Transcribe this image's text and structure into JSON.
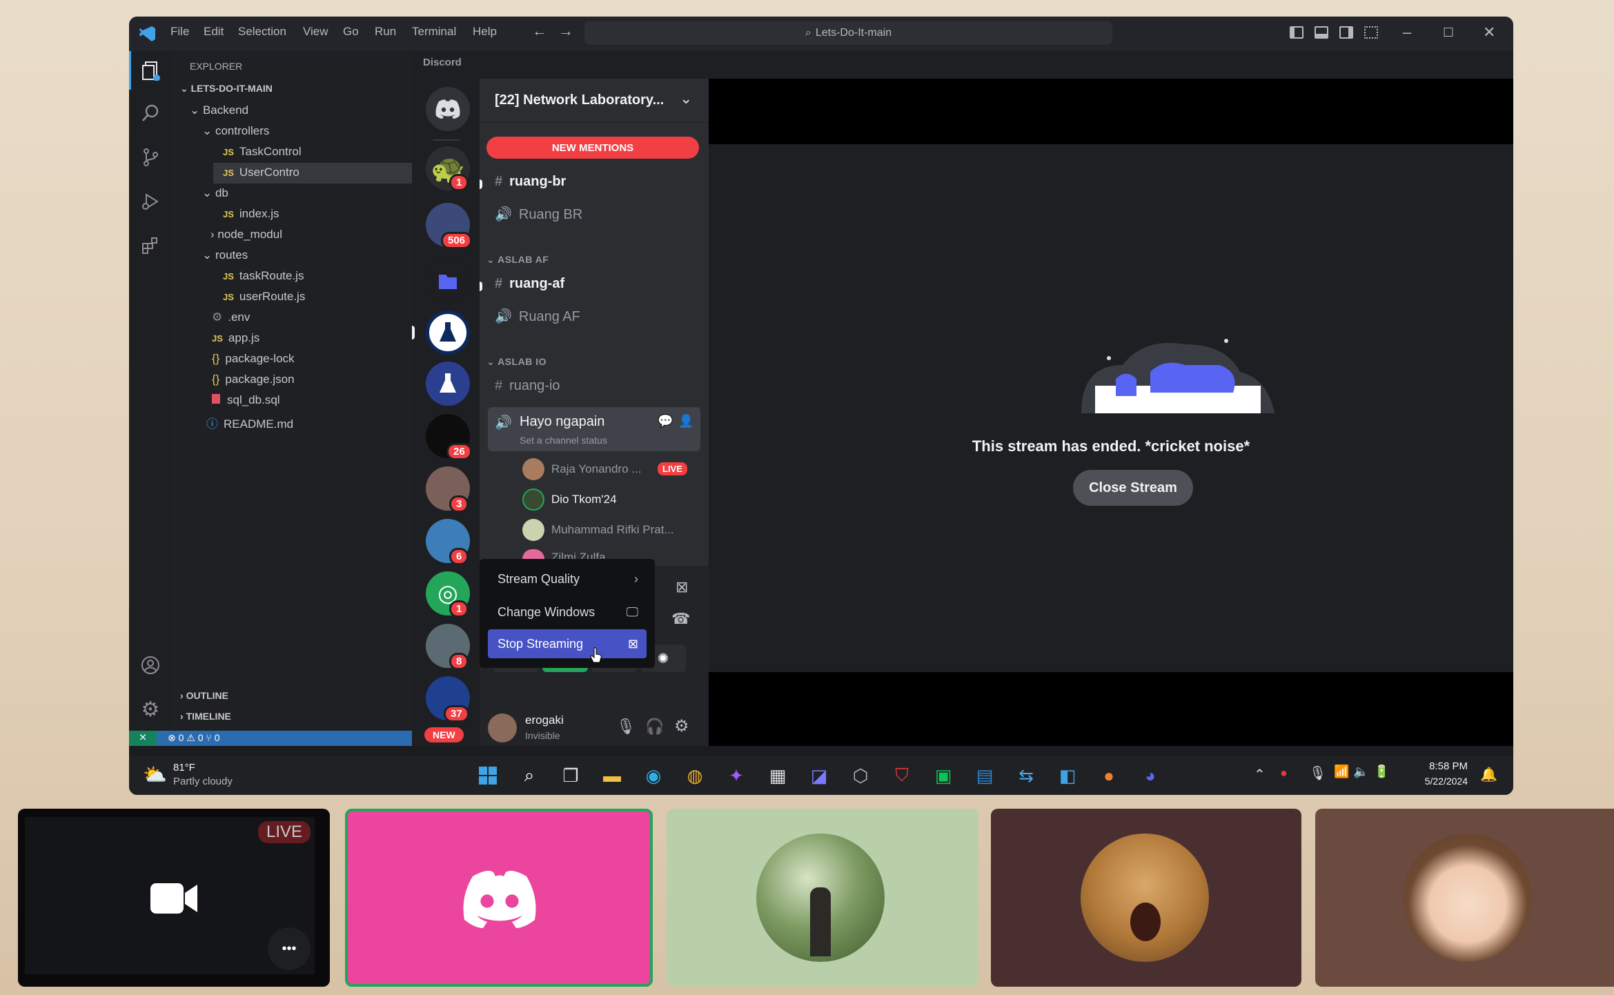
{
  "titlebar": {
    "menus": [
      "File",
      "Edit",
      "Selection",
      "View",
      "Go",
      "Run",
      "Terminal",
      "Help"
    ],
    "search": "Lets-Do-It-main"
  },
  "explorer": {
    "title": "EXPLORER",
    "root": "LETS-DO-IT-MAIN",
    "items": [
      "Backend",
      "controllers",
      "TaskControl",
      "UserContro",
      "db",
      "index.js",
      "node_modul",
      "routes",
      "taskRoute.js",
      "userRoute.js",
      ".env",
      "app.js",
      "package-lock",
      "package.json",
      "sql_db.sql",
      "README.md"
    ],
    "outline": "OUTLINE",
    "timeline": "TIMELINE",
    "status": "⊗ 0 ⚠ 0   ⑂ 0"
  },
  "discord": {
    "app_title": "Discord",
    "server_name": "[22] Network Laboratory...",
    "new_mentions": "NEW MENTIONS",
    "channels": {
      "ruang_br": "ruang-br",
      "ruang_br_voice": "Ruang BR",
      "cat_af": "ASLAB AF",
      "ruang_af": "ruang-af",
      "ruang_af_voice": "Ruang AF",
      "cat_io": "ASLAB IO",
      "ruang_io": "ruang-io",
      "hayo": "Hayo ngapain",
      "hayo_status": "Set a channel status"
    },
    "voice_users": [
      "Raja Yonandro ...",
      "Dio Tkom'24",
      "Muhammad Rifki Prat...",
      "Zilmi Zulfa"
    ],
    "live": "LIVE",
    "server_badges": [
      "1",
      "506",
      "26",
      "3",
      "6",
      "1",
      "8",
      "37"
    ],
    "new_pill": "NEW",
    "context_menu": {
      "stream_quality": "Stream Quality",
      "change_windows": "Change Windows",
      "stop_streaming": "Stop Streaming"
    },
    "user": {
      "name": "erogaki",
      "status": "Invisible"
    },
    "stream": {
      "ended_text": "This stream has ended. *cricket noise*",
      "close_button": "Close Stream"
    }
  },
  "taskbar": {
    "weather_temp": "81°F",
    "weather_desc": "Partly cloudy",
    "time": "8:58 PM",
    "date": "5/22/2024"
  },
  "tiles": {
    "live_badge": "LIVE",
    "more": "•••"
  },
  "colors": {
    "discord_blurple": "#5865f2",
    "discord_red": "#f23f43",
    "tile_pink": "#eb459e",
    "tile_green": "#b9cfa9",
    "tile_brown1": "#4a2f31",
    "tile_brown2": "#6b4a3f"
  }
}
